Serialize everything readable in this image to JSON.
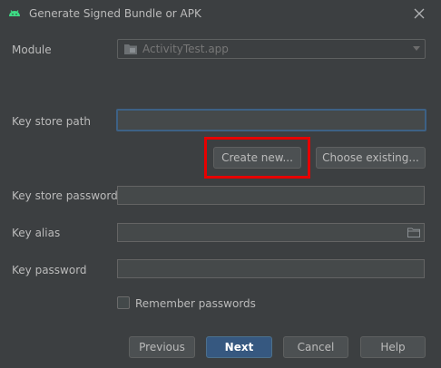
{
  "window": {
    "title": "Generate Signed Bundle or APK",
    "title_icon": "android-icon",
    "close_icon": "close-icon"
  },
  "form": {
    "module_label": "Module",
    "module_value": "ActivityTest.app",
    "key_store_path_label": "Key store path",
    "key_store_path_value": "",
    "create_new_label": "Create new...",
    "choose_existing_label": "Choose existing...",
    "key_store_password_label": "Key store password",
    "key_alias_label": "Key alias",
    "key_alias_value": "",
    "key_password_label": "Key password",
    "remember_passwords_label": "Remember passwords",
    "remember_passwords_checked": false
  },
  "footer": {
    "previous_label": "Previous",
    "next_label": "Next",
    "cancel_label": "Cancel",
    "help_label": "Help"
  },
  "colors": {
    "background": "#3c3f41",
    "primary_button": "#365880",
    "focus_border": "#3d6185",
    "highlight_box": "#e60000",
    "android_green": "#3ddc84"
  }
}
